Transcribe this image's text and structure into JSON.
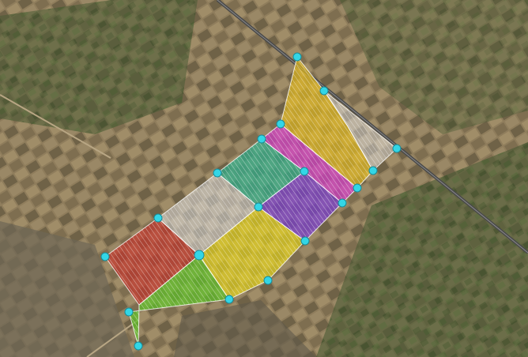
{
  "map": {
    "view": "satellite",
    "colors": {
      "ground": "#8f7d5c",
      "ground_dark": "#5c523d",
      "field_green": "#3f5a2e",
      "road": "#4a4a4a",
      "vertex": "#33d6e6",
      "hatch": "#ffffff"
    },
    "plots": [
      {
        "id": "plot-red",
        "color": "#c2392f"
      },
      {
        "id": "plot-green",
        "color": "#5fc22a"
      },
      {
        "id": "plot-white",
        "color": "#d8d8d8"
      },
      {
        "id": "plot-yellow-mid",
        "color": "#e3d21d"
      },
      {
        "id": "plot-teal",
        "color": "#2fae8c"
      },
      {
        "id": "plot-purple",
        "color": "#7a3fd0"
      },
      {
        "id": "plot-magenta",
        "color": "#d23fc8"
      },
      {
        "id": "plot-yellow-top",
        "color": "#e0b820"
      },
      {
        "id": "plot-white-top",
        "color": "#e6e6e6"
      }
    ]
  }
}
